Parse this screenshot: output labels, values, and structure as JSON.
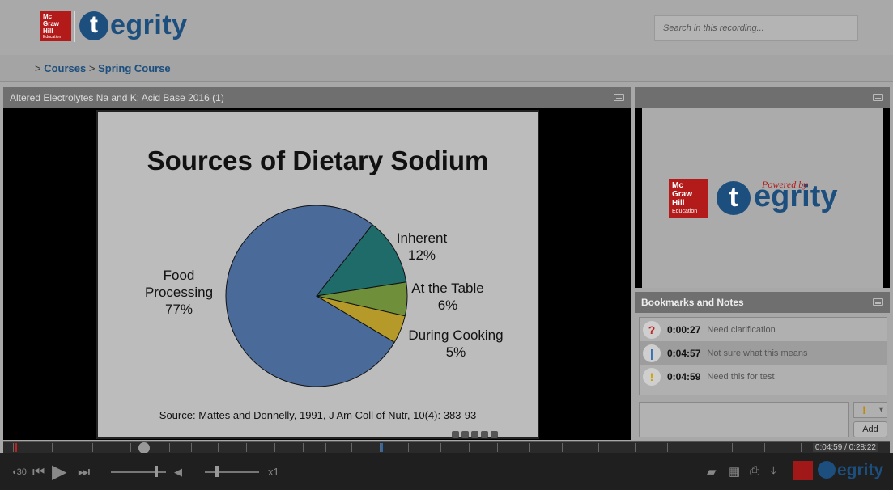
{
  "header": {
    "logo_text": "tegrity",
    "logo_t": "t",
    "logo_rest": "egrity",
    "mgh_line1": "Mc",
    "mgh_line2": "Graw",
    "mgh_line3": "Hill",
    "mgh_line4": "Education",
    "search_placeholder": "Search in this recording..."
  },
  "breadcrumb": {
    "sep": ">",
    "courses": "Courses",
    "course": "Spring Course"
  },
  "recording": {
    "title": "Altered Electrolytes Na and K; Acid Base 2016 (1)"
  },
  "slide": {
    "title": "Sources of Dietary Sodium",
    "source": "Source: Mattes and Donnelly, 1991, J Am Coll of Nutr, 10(4): 383-93"
  },
  "chart_data": {
    "type": "pie",
    "title": "Sources of Dietary Sodium",
    "categories": [
      "Food Processing",
      "Inherent",
      "At the Table",
      "During Cooking"
    ],
    "values": [
      77,
      12,
      6,
      5
    ],
    "labels": [
      {
        "line1": "Food",
        "line2": "Processing",
        "line3": "77%"
      },
      {
        "line1": "Inherent",
        "line2": "12%"
      },
      {
        "line1": "At the Table",
        "line2": "6%"
      },
      {
        "line1": "During Cooking",
        "line2": "5%"
      }
    ],
    "colors": [
      "#4a6b9a",
      "#1f6b6a",
      "#6f8f3a",
      "#b59a2a"
    ]
  },
  "right_logo": {
    "powered": "Powered by",
    "t": "t",
    "rest": "egrity"
  },
  "bookmarks": {
    "title": "Bookmarks and Notes",
    "items": [
      {
        "icon": "?",
        "time": "0:00:27",
        "text": "Need clarification",
        "color": "#c02020"
      },
      {
        "icon": "|",
        "time": "0:04:57",
        "text": "Not sure what this means",
        "color": "#2a6ab0"
      },
      {
        "icon": "!",
        "time": "0:04:59",
        "text": "Need this for test",
        "color": "#d0a000"
      }
    ],
    "add_label": "Add",
    "type_symbol": "!"
  },
  "player": {
    "timecode": "0:04:59 / 0:28:22",
    "speed": "x1",
    "skip_label": "30"
  }
}
